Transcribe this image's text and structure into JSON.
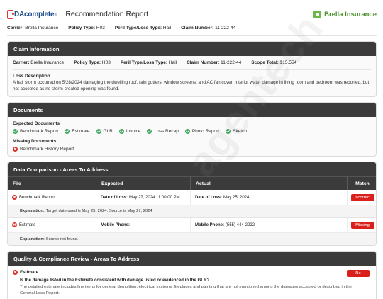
{
  "header": {
    "logo_text": "DAcomplete",
    "logo_tm": "®",
    "report_title": "Recommendation Report",
    "client_name": "Brella Insurance"
  },
  "summary": {
    "carrier_label": "Carrier:",
    "carrier": "Brella Insurance",
    "policy_label": "Policy Type:",
    "policy": "H03",
    "peril_label": "Peril Type/Loss Type:",
    "peril": "Hail",
    "claim_label": "Claim Number:",
    "claim": "11-222-44"
  },
  "claim_info": {
    "title": "Claim Information",
    "carrier_label": "Carrier:",
    "carrier": "Brella Insurance",
    "policy_label": "Policy Type:",
    "policy": "H03",
    "peril_label": "Peril Type/Loss Type:",
    "peril": "Hail",
    "claim_label": "Claim Number:",
    "claim": "11-222-44",
    "scope_label": "Scope Total:",
    "scope": "$15,554",
    "loss_label": "Loss Description",
    "loss_text": "A hail storm occurred on 5/28/2024 damaging the dwelling roof, rain gutters, window screens, and AC fan cover. Interior water damage in living room and bedroom was reported, but not accepted as no storm-created opening was found."
  },
  "documents": {
    "title": "Documents",
    "expected_label": "Expected Documents",
    "expected": [
      "Benchmark Report",
      "Estimate",
      "GLR",
      "Invoice",
      "Loss Recap",
      "Photo Report",
      "Sketch"
    ],
    "missing_label": "Missing Documents",
    "missing": [
      "Benchmark History Report"
    ]
  },
  "comparison": {
    "title": "Data Comparison - Areas To Address",
    "columns": [
      "File",
      "Expected",
      "Actual",
      "Match"
    ],
    "rows": [
      {
        "file": "Benchmark Report",
        "expected_label": "Date of Loss:",
        "expected": "May 27, 2024 11:00:00 PM",
        "actual_label": "Date of Loss:",
        "actual": "May 25, 2024",
        "match": "Incorrect",
        "explanation_label": "Explanation:",
        "explanation": "Target date used is May 25, 2024. Source is May 27, 2024"
      },
      {
        "file": "Estimate",
        "expected_label": "Mobile Phone:",
        "expected": "-",
        "actual_label": "Mobile Phone:",
        "actual": "(555) 444-2222",
        "match": "Missing",
        "explanation_label": "Explanation:",
        "explanation": "Source not found."
      }
    ]
  },
  "quality": {
    "title": "Quality & Compliance Review - Areas To Address",
    "item": "Estimate",
    "question": "Is the damage listed in the Estimate consistent with damage listed or evidenced in the GLR?",
    "explanation": "The detailed estimate includes line items for general demolition, electrical systems, fireplaces and painting that are not mentioned among the damages accepted or described in the General Loss Report.",
    "result": "No"
  },
  "watermark": "agentech",
  "colors": {
    "header_dark": "#3b3b3b",
    "ok_green": "#3da45a",
    "alert_red": "#d9201c",
    "brand_green": "#6cb94a",
    "logo_blue": "#1f4e8c"
  }
}
